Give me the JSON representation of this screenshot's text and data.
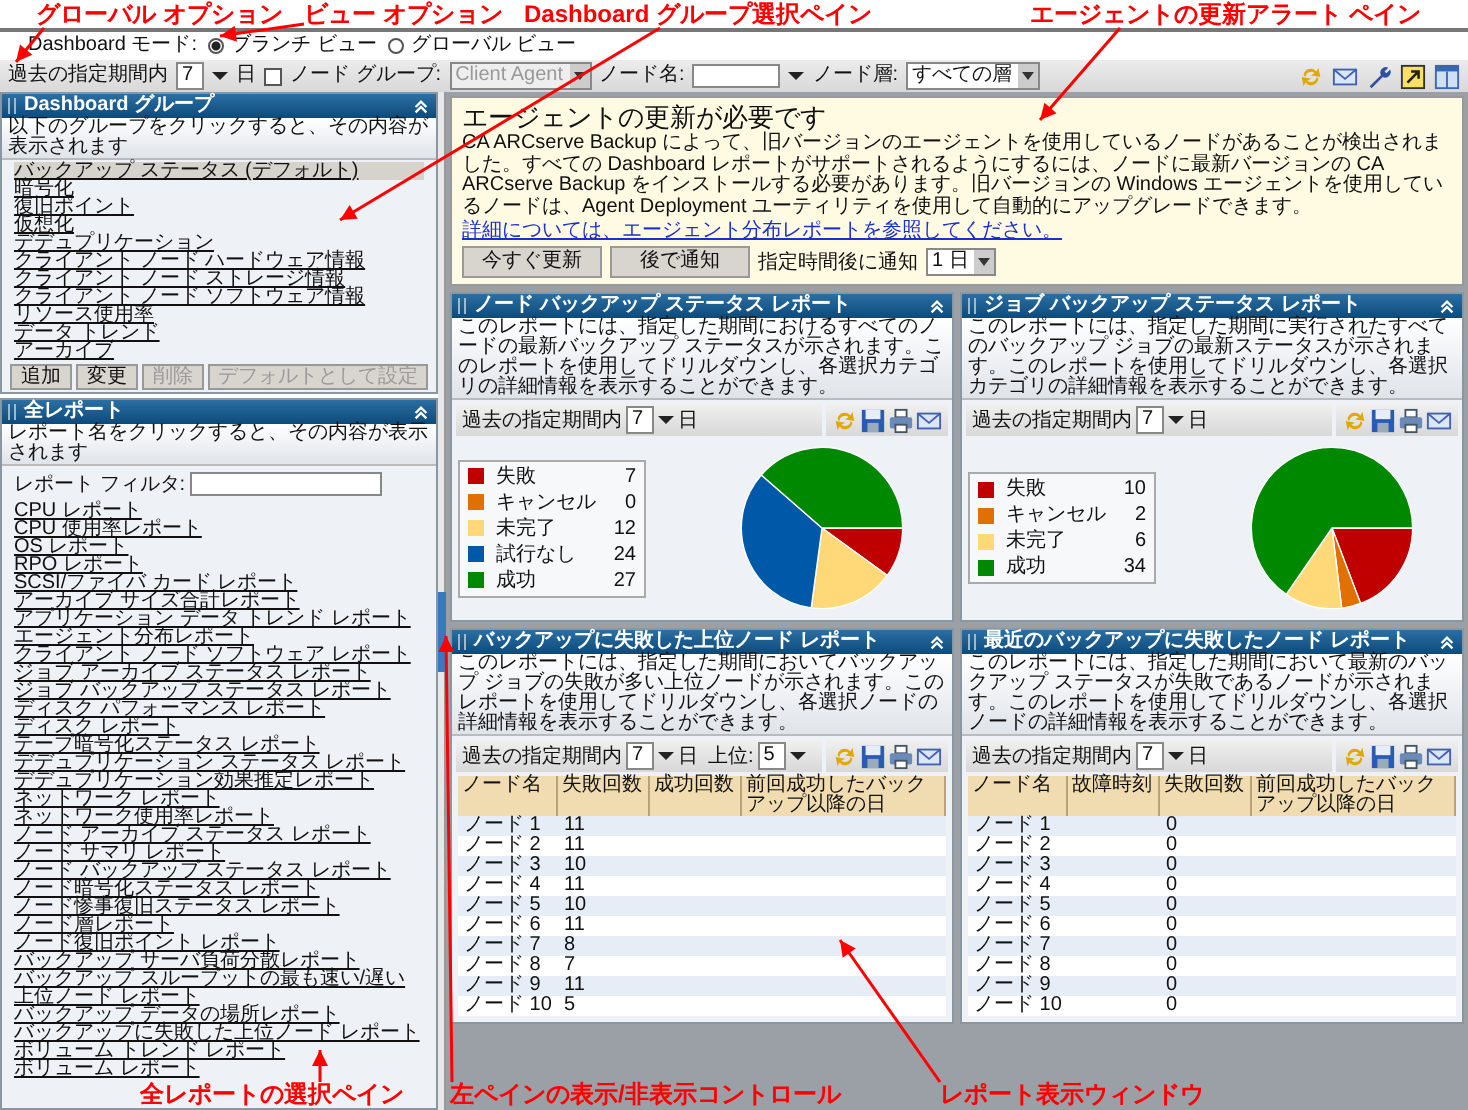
{
  "callouts": [
    {
      "text": "グローバル オプション"
    },
    {
      "text": "ビュー オプション"
    },
    {
      "text": "Dashboard グループ選択ペイン"
    },
    {
      "text": "エージェントの更新アラート ペイン"
    },
    {
      "text": "全レポートの選択ペイン"
    },
    {
      "text": "左ペインの表示/非表示コントロール"
    },
    {
      "text": "レポート表示ウィンドウ"
    }
  ],
  "mode": {
    "label": "Dashboard モード:",
    "options": [
      {
        "label": "ブランチ ビュー",
        "selected": true
      },
      {
        "label": "グローバル ビュー",
        "selected": false
      }
    ]
  },
  "toolbar": {
    "period_label": "過去の指定期間内",
    "period_value": "7",
    "period_unit": "日",
    "node_group": {
      "label": "ノード グループ:",
      "checked": false,
      "value": "Client Agent",
      "disabled": true
    },
    "node_name": {
      "label": "ノード名:"
    },
    "node_tier": {
      "label": "ノード層:",
      "value": "すべての層"
    }
  },
  "group_pane": {
    "title": "Dashboard グループ",
    "description": "以下のグループをクリックすると、その内容が表示されます",
    "items": [
      {
        "label": "バックアップ ステータス (デフォルト)",
        "selected": true
      },
      {
        "label": "暗号化",
        "selected": false
      },
      {
        "label": "復旧ポイント",
        "selected": false
      },
      {
        "label": "仮想化",
        "selected": false
      },
      {
        "label": "デデュプリケーション",
        "selected": false
      },
      {
        "label": "クライアント ノード ハードウェア情報",
        "selected": false
      },
      {
        "label": "クライアント ノード ストレージ情報",
        "selected": false
      },
      {
        "label": "クライアント ノード ソフトウェア情報",
        "selected": false
      },
      {
        "label": "リソース使用率",
        "selected": false
      },
      {
        "label": "データ トレンド",
        "selected": false
      },
      {
        "label": "アーカイブ",
        "selected": false
      }
    ],
    "buttons": [
      {
        "label": "追加",
        "disabled": false
      },
      {
        "label": "変更",
        "disabled": false
      },
      {
        "label": "削除",
        "disabled": true
      },
      {
        "label": "デフォルトとして設定",
        "disabled": true
      }
    ]
  },
  "reports_pane": {
    "title": "全レポート",
    "description": "レポート名をクリックすると、その内容が表示されます",
    "filter_label": "レポート フィルタ:",
    "items": [
      "CPU レポート",
      "CPU 使用率レポート",
      "OS レポート",
      "RPO レポート",
      "SCSI/ファイバ カード レポート",
      "アーカイブ サイズ合計レポート",
      "アプリケーション データ トレンド レポート",
      "エージェント分布レポート",
      "クライアント ノード ソフトウェア レポート",
      "ジョブ アーカイブ ステータス レポート",
      "ジョブ バックアップ ステータス レポート",
      "ディスク パフォーマンス レポート",
      "ディスク レポート",
      "テープ暗号化ステータス レポート",
      "デデュプリケーション ステータス レポート",
      "デデュプリケーション効果推定レポート",
      "ネットワーク レポート",
      "ネットワーク使用率レポート",
      "ノード アーカイブ ステータス レポート",
      "ノード サマリ レポート",
      "ノード バックアップ ステータス レポート",
      "ノード暗号化ステータス レポート",
      "ノード惨事復旧ステータス レポート",
      "ノード層レポート",
      "ノード復旧ポイント レポート",
      "バックアップ サーバ負荷分散レポート",
      "バックアップ スループットの最も速い/遅い上位ノード レポート",
      "バックアップ データの場所レポート",
      "バックアップに失敗した上位ノード レポート",
      "ボリューム トレンド レポート",
      "ボリューム レポート"
    ]
  },
  "alert": {
    "title": "エージェントの更新が必要です",
    "body": "CA ARCserve Backup によって、旧バージョンのエージェントを使用しているノードがあることが検出されました。すべての Dashboard レポートがサポートされるようにするには、ノードに最新バージョンの CA ARCserve Backup をインストールする必要があります。旧バージョンの Windows エージェントを使用しているノードは、Agent Deployment ユーティリティを使用して自動的にアップグレードできます。",
    "link": "詳細については、エージェント分布レポートを参照してください。",
    "buttons": [
      "今すぐ更新",
      "後で通知"
    ],
    "notify_label": "指定時間後に通知",
    "notify_value": "1 日"
  },
  "reports": [
    {
      "kind": "pie",
      "title": "ノード バックアップ ステータス レポート",
      "description": "このレポートには、指定した期間におけるすべてのノードの最新バックアップ ステータスが示されます。このレポートを使用してドリルダウンし、各選択カテゴリの詳細情報を表示することができます。",
      "period_label": "過去の指定期間内",
      "period_value": "7",
      "period_unit": "日",
      "swatches": [
        {
          "color": "#c00000"
        },
        {
          "color": "#e07000"
        },
        {
          "color": "#ffd878"
        },
        {
          "color": "#0058a8"
        },
        {
          "color": "#008800"
        }
      ],
      "chart_data": {
        "type": "pie",
        "legend": "left",
        "categories": [
          "失敗",
          "キャンセル",
          "未完了",
          "試行なし",
          "成功"
        ],
        "values": [
          7,
          0,
          12,
          24,
          27
        ],
        "value_labels": [
          "7",
          "0",
          "12",
          "24",
          "27"
        ]
      }
    },
    {
      "kind": "pie",
      "title": "ジョブ バックアップ ステータス レポート",
      "description": "このレポートには、指定した期間に実行されたすべてのバックアップ ジョブの最新ステータスが示されます。このレポートを使用してドリルダウンし、各選択カテゴリの詳細情報を表示することができます。",
      "period_label": "過去の指定期間内",
      "period_value": "7",
      "period_unit": "日",
      "swatches": [
        {
          "color": "#c00000"
        },
        {
          "color": "#e07000"
        },
        {
          "color": "#ffd878"
        },
        {
          "color": "#008800"
        }
      ],
      "chart_data": {
        "type": "pie",
        "legend": "left",
        "categories": [
          "失敗",
          "キャンセル",
          "未完了",
          "成功"
        ],
        "values": [
          10,
          2,
          6,
          34
        ],
        "value_labels": [
          "10",
          "2",
          "6",
          "34"
        ]
      }
    },
    {
      "kind": "table",
      "title": "バックアップに失敗した上位ノード レポート",
      "description": "このレポートには、指定した期間においてバックアップ ジョブの失敗が多い上位ノードが示されます。このレポートを使用してドリルダウンし、各選択ノードの詳細情報を表示することができます。",
      "period_label": "過去の指定期間内",
      "period_value": "7",
      "period_unit": "日",
      "top_label": "上位:",
      "top_value": "5",
      "columns": [
        {
          "label": "ノード名",
          "kind": "text"
        },
        {
          "label": "失敗回数",
          "kind": "text"
        },
        {
          "label": "成功回数",
          "kind": "blank"
        },
        {
          "label": "前回成功したバックアップ以降の日",
          "kind": "blank"
        }
      ],
      "rows": [
        {
          "cells": [
            "ノード 1",
            "11"
          ]
        },
        {
          "cells": [
            "ノード 2",
            "11"
          ]
        },
        {
          "cells": [
            "ノード 3",
            "10"
          ]
        },
        {
          "cells": [
            "ノード 4",
            "11"
          ]
        },
        {
          "cells": [
            "ノード 5",
            "10"
          ]
        },
        {
          "cells": [
            "ノード 6",
            "11"
          ]
        },
        {
          "cells": [
            "ノード 7",
            "8"
          ]
        },
        {
          "cells": [
            "ノード 8",
            "7"
          ]
        },
        {
          "cells": [
            "ノード 9",
            "11"
          ]
        },
        {
          "cells": [
            "ノード 10",
            "5"
          ]
        }
      ]
    },
    {
      "kind": "table",
      "title": "最近のバックアップに失敗したノード レポート",
      "description": "このレポートには、指定した期間において最新のバックアップ ステータスが失敗であるノードが示されます。このレポートを使用してドリルダウンし、各選択ノードの詳細情報を表示することができます。",
      "period_label": "過去の指定期間内",
      "period_value": "7",
      "period_unit": "日",
      "columns": [
        {
          "label": "ノード名",
          "kind": "text"
        },
        {
          "label": "故障時刻",
          "kind": "blank"
        },
        {
          "label": "失敗回数",
          "kind": "text"
        },
        {
          "label": "前回成功したバックアップ以降の日",
          "kind": "blank"
        }
      ],
      "rows": [
        {
          "cells": [
            "ノード 1",
            "0"
          ]
        },
        {
          "cells": [
            "ノード 2",
            "0"
          ]
        },
        {
          "cells": [
            "ノード 3",
            "0"
          ]
        },
        {
          "cells": [
            "ノード 4",
            "0"
          ]
        },
        {
          "cells": [
            "ノード 5",
            "0"
          ]
        },
        {
          "cells": [
            "ノード 6",
            "0"
          ]
        },
        {
          "cells": [
            "ノード 7",
            "0"
          ]
        },
        {
          "cells": [
            "ノード 8",
            "0"
          ]
        },
        {
          "cells": [
            "ノード 9",
            "0"
          ]
        },
        {
          "cells": [
            "ノード 10",
            "0"
          ]
        }
      ]
    }
  ]
}
